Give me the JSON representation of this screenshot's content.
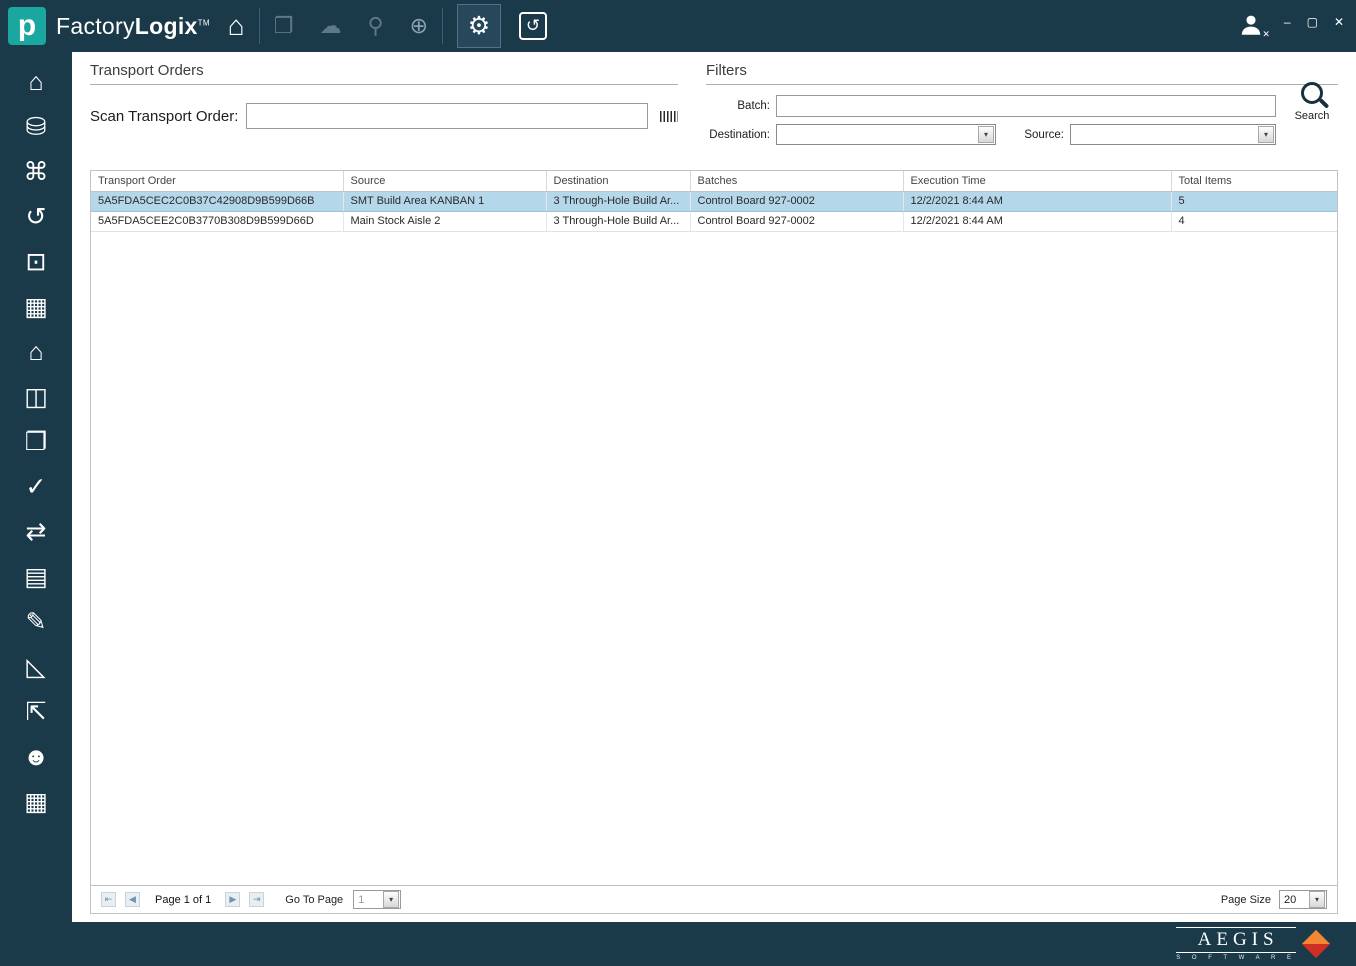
{
  "header": {
    "logo_letter": "p",
    "brand_part1": "Factory",
    "brand_part2": "Logix",
    "trademark": "TM",
    "home_glyph": "⌂",
    "nav_icons": [
      {
        "name": "documents",
        "glyph": "❐",
        "bright": false
      },
      {
        "name": "cloud",
        "glyph": "☁",
        "bright": false
      },
      {
        "name": "location-pin",
        "glyph": "⚲",
        "bright": false
      },
      {
        "name": "globe",
        "glyph": "⊕",
        "bright": true
      }
    ],
    "settings_glyph": "⚙",
    "undo_glyph": "↺",
    "window": {
      "minimize": "–",
      "maximize": "▢",
      "close": "✕"
    }
  },
  "sidebar": {
    "items": [
      {
        "name": "home",
        "glyph": "⌂"
      },
      {
        "name": "database-edit",
        "glyph": "⛁"
      },
      {
        "name": "process-flow",
        "glyph": "⌘"
      },
      {
        "name": "undo-history",
        "glyph": "↺"
      },
      {
        "name": "monitor",
        "glyph": "⊡"
      },
      {
        "name": "table-search",
        "glyph": "▦"
      },
      {
        "name": "warehouse",
        "glyph": "⌂"
      },
      {
        "name": "book",
        "glyph": "◫"
      },
      {
        "name": "copy",
        "glyph": "❐"
      },
      {
        "name": "verify-tasks",
        "glyph": "✓"
      },
      {
        "name": "transfer-items",
        "glyph": "⇄"
      },
      {
        "name": "id-card",
        "glyph": "▤"
      },
      {
        "name": "document-edit",
        "glyph": "✎"
      },
      {
        "name": "design-check",
        "glyph": "◺"
      },
      {
        "name": "package-return",
        "glyph": "⇱"
      },
      {
        "name": "user-question",
        "glyph": "☻"
      },
      {
        "name": "schedule",
        "glyph": "▦"
      }
    ]
  },
  "main": {
    "transport_orders": {
      "title": "Transport Orders",
      "scan_label": "Scan Transport Order:",
      "scan_value": ""
    },
    "filters": {
      "title": "Filters",
      "batch_label": "Batch:",
      "batch_value": "",
      "destination_label": "Destination:",
      "destination_value": "",
      "source_label": "Source:",
      "source_value": "",
      "search_label": "Search"
    },
    "table": {
      "columns": [
        "Transport Order",
        "Source",
        "Destination",
        "Batches",
        "Execution Time",
        "Total Items"
      ],
      "rows": [
        {
          "selected": true,
          "cells": [
            "5A5FDA5CEC2C0B37C42908D9B599D66B",
            "SMT Build Area KANBAN 1",
            "3 Through-Hole Build Ar...",
            "Control Board 927-0002",
            "12/2/2021 8:44 AM",
            "5"
          ]
        },
        {
          "selected": false,
          "cells": [
            "5A5FDA5CEE2C0B3770B308D9B599D66D",
            "Main Stock Aisle 2",
            "3 Through-Hole Build Ar...",
            "Control Board 927-0002",
            "12/2/2021 8:44 AM",
            "4"
          ]
        }
      ]
    },
    "pagination": {
      "first_glyph": "⇤",
      "prev_glyph": "◀",
      "next_glyph": "▶",
      "last_glyph": "⇥",
      "page_text": "Page 1 of 1",
      "go_to_page_label": "Go To Page",
      "go_to_page_value": "1",
      "dropdown_glyph": "▾",
      "page_size_label": "Page Size",
      "page_size_value": "20"
    }
  },
  "footer": {
    "brand": "AEGIS",
    "subtitle": "S O F T W A R E"
  },
  "colors": {
    "navy": "#1b3a49",
    "teal": "#1aa7a0",
    "selected_row": "#b4d7ea",
    "accent_orange": "#f58634",
    "accent_red": "#cf2e24"
  }
}
